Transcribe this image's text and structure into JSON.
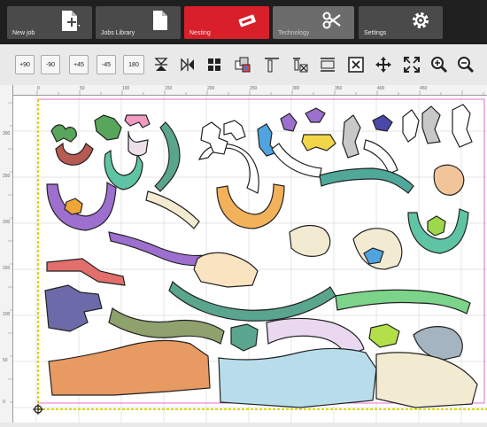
{
  "modes": {
    "new_job": "New job",
    "jobs_library": "Jobs Library",
    "nesting": "Nesting",
    "technology": "Technology",
    "settings": "Settings"
  },
  "toolbar": {
    "rot_plus_90": "+90",
    "rot_minus_90": "-90",
    "rot_plus_45": "+45",
    "rot_minus_45": "-45",
    "rot_180": "180"
  },
  "ruler": {
    "top_labels": [
      "0",
      "50",
      "100",
      "150",
      "200",
      "250",
      "300",
      "350",
      "400",
      "450"
    ],
    "left_labels": [
      "0",
      "50",
      "100",
      "150",
      "200",
      "250",
      "300"
    ]
  },
  "colors": {
    "nesting_active": "#d81f2a",
    "top_bar": "#1f1f1f",
    "sheet_border_dashed": "#e0e000",
    "sheet_border": "#e040c0"
  }
}
